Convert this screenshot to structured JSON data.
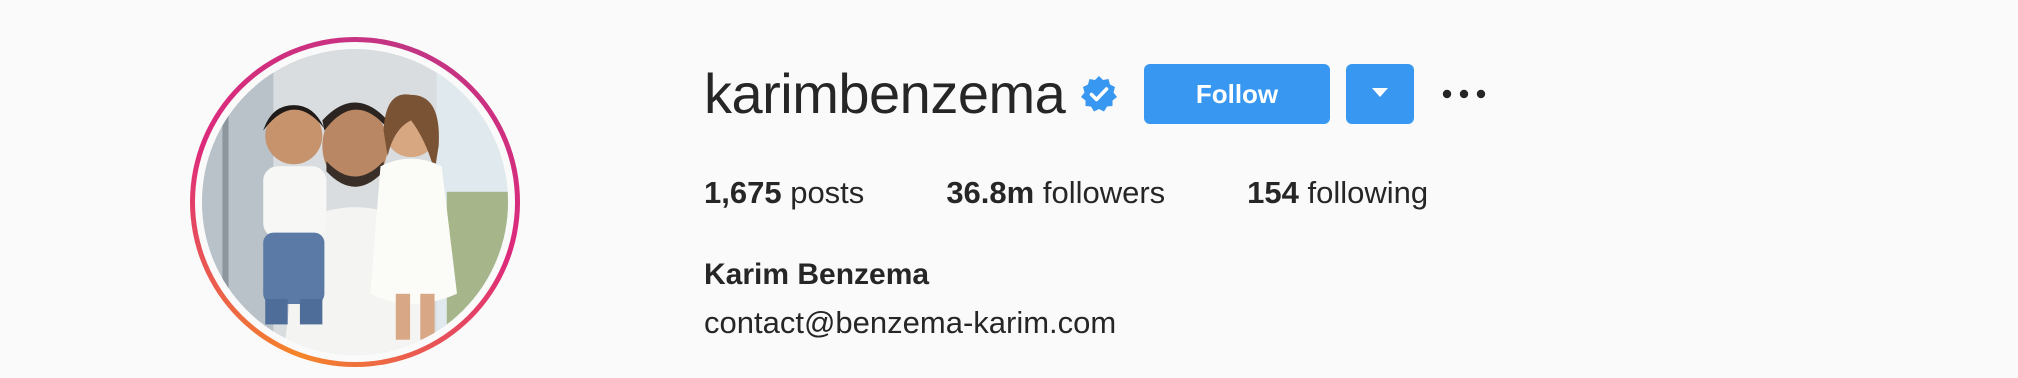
{
  "profile": {
    "username": "karimbenzema",
    "verified": true,
    "full_name": "Karim Benzema",
    "bio_email": "contact@benzema-karim.com",
    "avatar_icon": "profile-photo"
  },
  "actions": {
    "follow_label": "Follow",
    "dropdown_icon": "chevron-down-icon",
    "more_icon": "more-options-icon"
  },
  "stats": {
    "posts_count": "1,675",
    "posts_label": "posts",
    "followers_count": "36.8m",
    "followers_label": "followers",
    "following_count": "154",
    "following_label": "following"
  },
  "colors": {
    "follow_button": "#3897f0",
    "verified_badge": "#3897f0",
    "text": "#262626",
    "background": "#fafafa",
    "story_ring_start": "#f58529",
    "story_ring_end": "#c13584"
  }
}
